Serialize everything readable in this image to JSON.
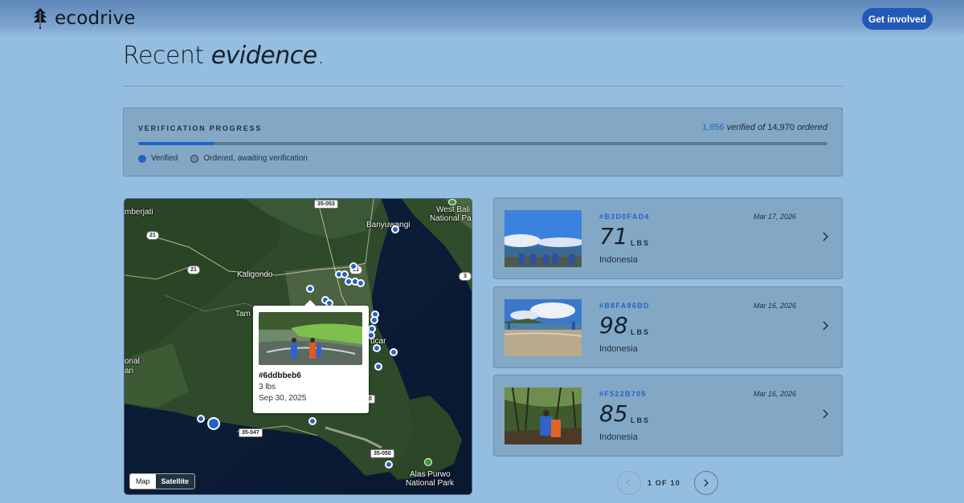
{
  "brand": {
    "name": "ecodrive"
  },
  "header": {
    "cta_label": "Get involved"
  },
  "heading": {
    "prefix": "Recent ",
    "emphasis": "evidence",
    "suffix": "."
  },
  "verification": {
    "title": "VERIFICATION PROGRESS",
    "verified_count": "1,656",
    "verified_text": " verified of ",
    "ordered_count": "14,970",
    "ordered_text": " ordered",
    "progress_fraction": 0.1106,
    "legend": {
      "verified": "Verified",
      "ordered": "Ordered, awaiting verification"
    },
    "colors": {
      "verified": "#2462c9",
      "ordered": "#5d7891"
    }
  },
  "map": {
    "labels": {
      "jember": "mberjati",
      "west_bali_1": "West Bali",
      "west_bali_2": "National Park",
      "banyuwangi": "Banyuwangi",
      "kaligondo": "Kaligondo",
      "tam": "Tam",
      "onal": "onal",
      "ari": "ari",
      "ucar": "ucar",
      "alas_1": "Alas Purwo",
      "alas_2": "National Park"
    },
    "roads": {
      "r1": "35-053",
      "r2": "21",
      "r3": "21",
      "r4": "21",
      "r5": "3",
      "r6": "35-047",
      "r7": "35-050",
      "r8": "0"
    },
    "popup": {
      "id": "#6ddbbeb6",
      "weight": "3 lbs",
      "date": "Sep 30, 2025"
    },
    "toggle": {
      "map": "Map",
      "satellite": "Satellite"
    }
  },
  "evidence": [
    {
      "id": "#B3D0FAD4",
      "date": "Mar 17, 2026",
      "weight": "71",
      "unit": "LBS",
      "country": "Indonesia"
    },
    {
      "id": "#B8FA96BD",
      "date": "Mar 16, 2026",
      "weight": "98",
      "unit": "LBS",
      "country": "Indonesia"
    },
    {
      "id": "#F522B705",
      "date": "Mar 16, 2026",
      "weight": "85",
      "unit": "LBS",
      "country": "Indonesia"
    }
  ],
  "pagination": {
    "label": "1 OF 10"
  }
}
